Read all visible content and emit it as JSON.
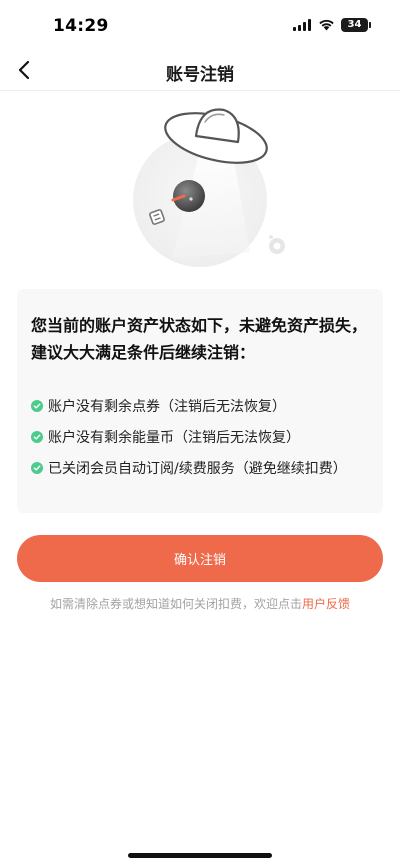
{
  "status_bar": {
    "time": "14:29",
    "battery_level": "34"
  },
  "nav": {
    "back_icon": "chevron-left-icon",
    "title": "账号注销"
  },
  "illustration": {
    "icon": "ufo-empty-illustration",
    "colors": {
      "accent": "#ee6a4b",
      "beam": "#efefef"
    }
  },
  "info": {
    "heading": "您当前的账户资产状态如下，未避免资产损失，建议大大满足条件后继续注销：",
    "conditions": [
      {
        "text": "账户没有剩余点券（注销后无法恢复）",
        "icon": "check-circle-icon"
      },
      {
        "text": "账户没有剩余能量币（注销后无法恢复）",
        "icon": "check-circle-icon"
      },
      {
        "text": "已关闭会员自动订阅/续费服务（避免继续扣费）",
        "icon": "check-circle-icon"
      }
    ]
  },
  "actions": {
    "confirm_label": "确认注销"
  },
  "hint": {
    "text": "如需清除点券或想知道如何关闭扣费，欢迎点击",
    "link": "用户反馈"
  },
  "colors": {
    "brand": "#ee6a4b",
    "success": "#4ccb8c",
    "card_bg": "#f8f8f8",
    "hint_text": "#a3a3a3"
  }
}
